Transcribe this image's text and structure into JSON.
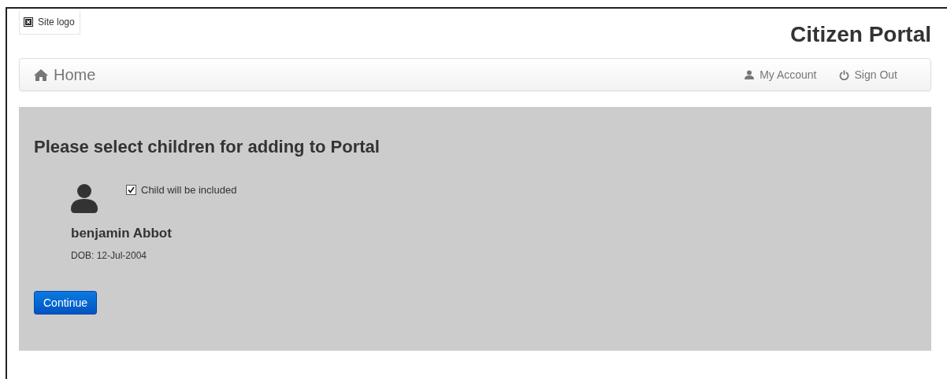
{
  "header": {
    "logo": "Site logo",
    "title": "Citizen Portal"
  },
  "navbar": {
    "home": "Home",
    "links": [
      {
        "kind": "account",
        "label": "My Account"
      },
      {
        "kind": "signout",
        "label": "Sign Out"
      }
    ]
  },
  "panel": {
    "heading": "Please select children for adding to Portal",
    "children": [
      {
        "checkbox_label": "Child will be included",
        "checked": true,
        "name": "benjamin Abbot",
        "dob": "DOB: 12-Jul-2004"
      }
    ],
    "button": "Continue"
  }
}
